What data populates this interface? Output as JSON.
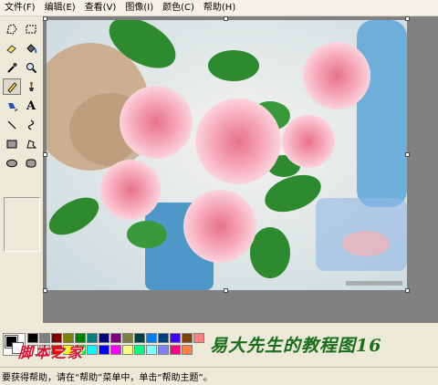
{
  "menu": [
    "文件(F)",
    "编辑(E)",
    "查看(V)",
    "图像(I)",
    "颜色(C)",
    "帮助(H)"
  ],
  "tools": [
    {
      "icon": "free-select-icon"
    },
    {
      "icon": "rect-select-icon"
    },
    {
      "icon": "eraser-icon"
    },
    {
      "icon": "fill-bucket-icon"
    },
    {
      "icon": "color-picker-icon"
    },
    {
      "icon": "magnifier-icon"
    },
    {
      "icon": "pencil-icon",
      "selected": true
    },
    {
      "icon": "brush-icon"
    },
    {
      "icon": "airbrush-icon"
    },
    {
      "icon": "text-icon",
      "label": "A"
    },
    {
      "icon": "line-icon"
    },
    {
      "icon": "curve-icon"
    },
    {
      "icon": "rectangle-icon"
    },
    {
      "icon": "polygon-icon"
    },
    {
      "icon": "ellipse-icon"
    },
    {
      "icon": "rounded-rect-icon"
    }
  ],
  "colors": {
    "foreground": "#000000",
    "background": "#ffffff",
    "palette_row1": [
      "#000000",
      "#808080",
      "#800000",
      "#808000",
      "#008000",
      "#008080",
      "#000080",
      "#800080",
      "#808040",
      "#004040",
      "#0080ff",
      "#004080",
      "#4000ff",
      "#804000",
      "#ff8080"
    ],
    "palette_row2": [
      "#ffffff",
      "#c0c0c0",
      "#ff0000",
      "#ffff00",
      "#00ff00",
      "#00ffff",
      "#0000ff",
      "#ff00ff",
      "#ffff80",
      "#00ff80",
      "#80ffff",
      "#8080ff",
      "#ff0080",
      "#ff8040"
    ]
  },
  "watermarks": {
    "site": "脚本之家",
    "credit": "易大先生的教程图16"
  },
  "status": {
    "text": "要获得帮助，请在“帮助”菜单中，单击“帮助主题”。"
  }
}
